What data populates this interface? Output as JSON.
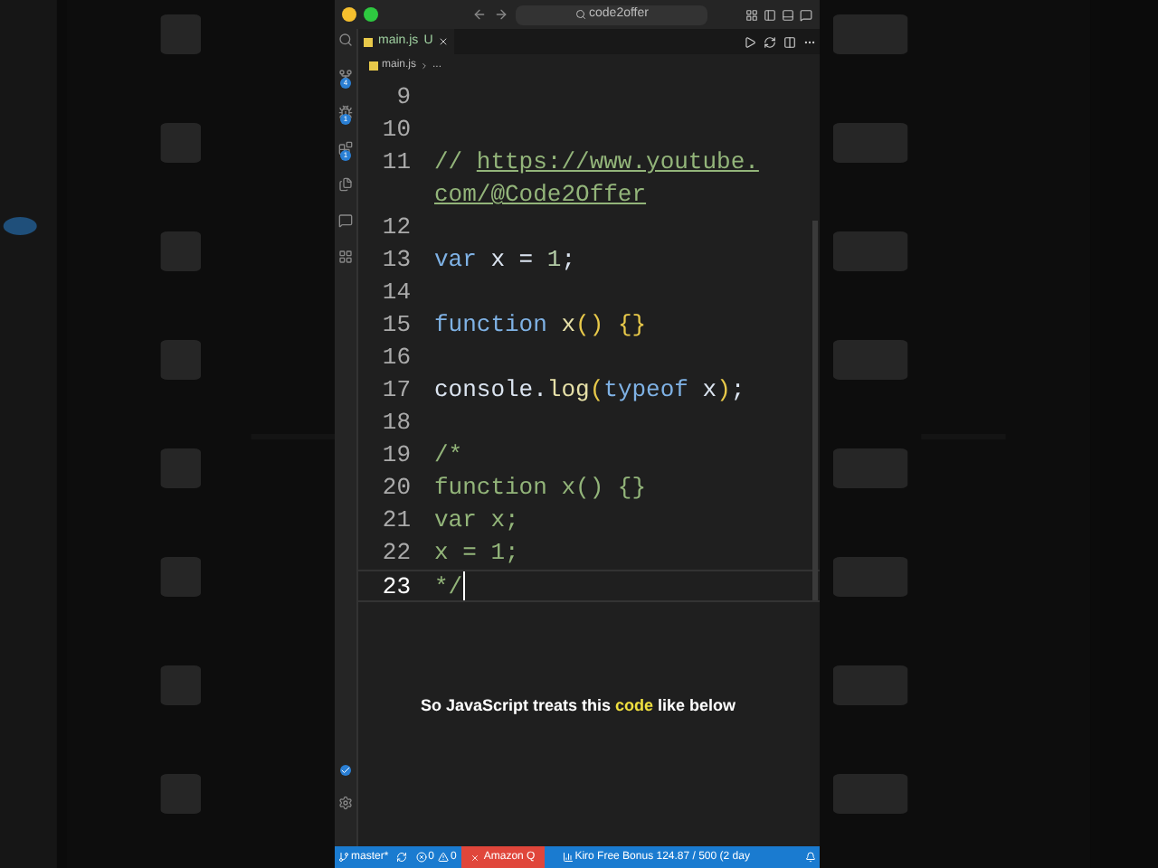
{
  "title_bar": {
    "search": "code2offer"
  },
  "activity_bar": {
    "badges": [
      {
        "text": "4",
        "kind": "count"
      },
      {
        "text": "1",
        "kind": "count"
      },
      {
        "text": "1",
        "kind": "count"
      },
      {
        "kind": "check"
      }
    ]
  },
  "tabs": [
    {
      "label": "main.js",
      "status": "U",
      "selected": true
    }
  ],
  "breadcrumb": {
    "file": "main.js",
    "rest": "..."
  },
  "editor": {
    "lines": [
      {
        "number": "9"
      },
      {
        "number": "10"
      },
      {
        "number": "11",
        "tokens": [
          {
            "text": "// ",
            "kind": "comment"
          },
          {
            "text": "https://www.youtube.",
            "kind": "link"
          }
        ]
      },
      {
        "tokens": [
          {
            "text": "com/@Code2Offer",
            "kind": "link"
          }
        ]
      },
      {
        "number": "12"
      },
      {
        "number": "13",
        "tokens": [
          {
            "text": "var",
            "kind": "keyword"
          },
          {
            "text": " x = ",
            "kind": "ident"
          },
          {
            "text": "1",
            "kind": "number"
          },
          {
            "text": ";",
            "kind": "punct"
          }
        ]
      },
      {
        "number": "14"
      },
      {
        "number": "15",
        "tokens": [
          {
            "text": "function",
            "kind": "keyword"
          },
          {
            "text": " x",
            "kind": "func"
          },
          {
            "text": "()",
            "kind": "bracket"
          },
          {
            "text": " {}",
            "kind": "bracket"
          }
        ]
      },
      {
        "number": "16"
      },
      {
        "number": "17",
        "tokens": [
          {
            "text": "console.",
            "kind": "ident"
          },
          {
            "text": "log",
            "kind": "func"
          },
          {
            "text": "(",
            "kind": "bracket"
          },
          {
            "text": "typeof",
            "kind": "keyword"
          },
          {
            "text": " x",
            "kind": "ident"
          },
          {
            "text": ")",
            "kind": "bracket"
          },
          {
            "text": ";",
            "kind": "punct"
          }
        ]
      },
      {
        "number": "18"
      },
      {
        "number": "19",
        "tokens": [
          {
            "text": "/*",
            "kind": "comment"
          }
        ]
      },
      {
        "number": "20",
        "tokens": [
          {
            "text": "function x() {}",
            "kind": "comment"
          }
        ]
      },
      {
        "number": "21",
        "tokens": [
          {
            "text": "var x;",
            "kind": "comment"
          }
        ]
      },
      {
        "number": "22",
        "tokens": [
          {
            "text": "x = 1;",
            "kind": "comment"
          }
        ]
      },
      {
        "number": "23",
        "tokens": [
          {
            "text": "*/",
            "kind": "comment"
          }
        ],
        "current": true
      }
    ]
  },
  "caption": [
    {
      "text": "So JavaScript treats this ",
      "highlight": false
    },
    {
      "text": "code",
      "highlight": true
    },
    {
      "text": " like below",
      "highlight": false
    }
  ],
  "status_bar": {
    "branch": "master*",
    "errors": "0",
    "warnings": "0",
    "amazon_q": "Amazon Q",
    "kiro": "Kiro Free Bonus 124.87 / 500 (2 day"
  }
}
